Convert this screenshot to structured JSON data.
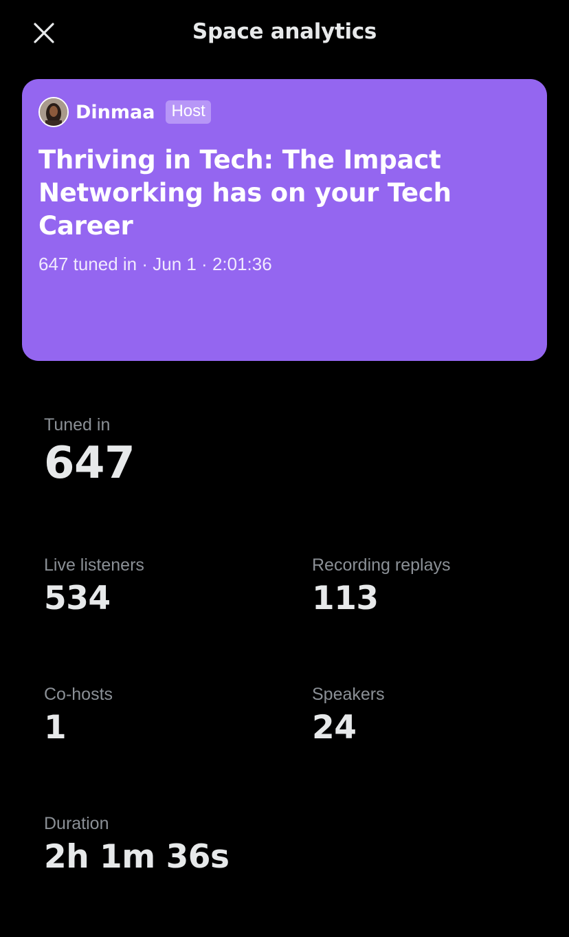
{
  "header": {
    "title": "Space analytics",
    "close_icon": "close-icon"
  },
  "card": {
    "background": "#9466F0",
    "host_name": "Dinmaa",
    "host_badge": "Host",
    "title": "Thriving in Tech: The Impact Networking has on your Tech Career",
    "meta": "647 tuned in · Jun 1 · 2:01:36"
  },
  "stats": {
    "tuned_in": {
      "label": "Tuned in",
      "value": "647"
    },
    "live_listeners": {
      "label": "Live listeners",
      "value": "534"
    },
    "recording_replays": {
      "label": "Recording replays",
      "value": "113"
    },
    "co_hosts": {
      "label": "Co-hosts",
      "value": "1"
    },
    "speakers": {
      "label": "Speakers",
      "value": "24"
    },
    "duration": {
      "label": "Duration",
      "value": "2h 1m 36s"
    }
  }
}
